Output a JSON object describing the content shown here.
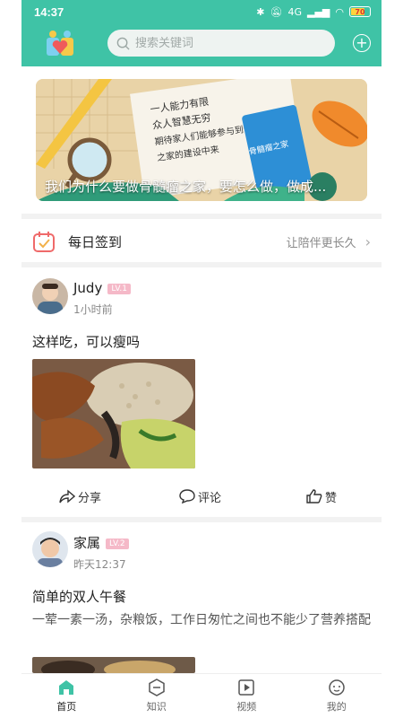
{
  "status_bar": {
    "time": "14:37",
    "battery": "70",
    "network": "4G"
  },
  "header": {
    "search_placeholder": "搜索关键词"
  },
  "banner": {
    "caption": "我们为什么要做骨髓瘤之家，要怎么做，做成...",
    "note_lines": [
      "一人能力有限",
      "众人智慧无穷",
      "期待家人们能够参与到骨髓瘤",
      "之家的建设中来"
    ],
    "book_title": "骨髓瘤之家"
  },
  "checkin": {
    "title": "每日签到",
    "subtitle": "让陪伴更长久"
  },
  "posts": [
    {
      "user": "Judy",
      "level": "LV.1",
      "time": "1小时前",
      "title": "这样吃，可以瘦吗",
      "actions": {
        "share": "分享",
        "comment": "评论",
        "like": "赞"
      }
    },
    {
      "user": "家属",
      "level": "LV.2",
      "time": "昨天12:37",
      "title": "简单的双人午餐",
      "desc": "一荤一素一汤，杂粮饭，工作日匆忙之间也不能少了营养搭配"
    }
  ],
  "tabbar": [
    {
      "label": "首页",
      "icon": "home-icon"
    },
    {
      "label": "知识",
      "icon": "knowledge-icon"
    },
    {
      "label": "视频",
      "icon": "video-icon"
    },
    {
      "label": "我的",
      "icon": "profile-icon"
    }
  ],
  "colors": {
    "brand": "#3fc3a6",
    "level_badge": "#f5b9c8"
  }
}
